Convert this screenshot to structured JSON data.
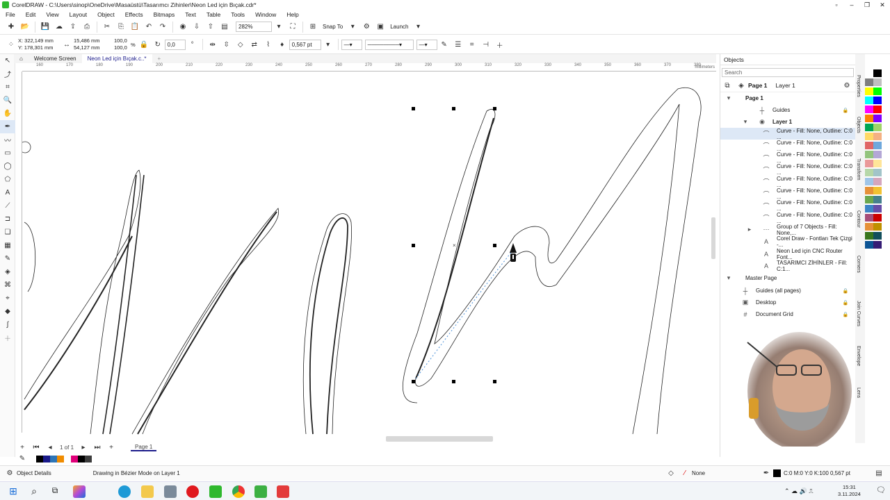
{
  "window": {
    "title": "CorelDRAW - C:\\Users\\sinop\\OneDrive\\Masaüstü\\Tasarımcı Zihinler\\Neon Led için Bıçak.cdr*"
  },
  "menu": [
    "File",
    "Edit",
    "View",
    "Layout",
    "Object",
    "Effects",
    "Bitmaps",
    "Text",
    "Table",
    "Tools",
    "Window",
    "Help"
  ],
  "toolbar": {
    "zoom": "282%",
    "snap_label": "Snap To",
    "launch_label": "Launch"
  },
  "propbar": {
    "x": "X: 322,149 mm",
    "y": "Y: 178,301 mm",
    "width": "15,486 mm",
    "height": "54,127 mm",
    "scale_x": "100,0",
    "scale_y": "100,0",
    "percent": "%",
    "angle": "0,0",
    "outline_width": "0,567 pt"
  },
  "tabs": {
    "welcome": "Welcome Screen",
    "document": "Neon Led için Bıçak.c..*",
    "add": "+"
  },
  "ruler": {
    "unit": "millimeters",
    "ticks": [
      "160",
      "170",
      "180",
      "190",
      "200",
      "210",
      "220",
      "230",
      "240",
      "250",
      "260",
      "270",
      "280",
      "290",
      "300",
      "310",
      "320",
      "330",
      "340",
      "350",
      "360",
      "370",
      "380"
    ]
  },
  "pagenav": {
    "counter": "1 of 1",
    "page_tab": "Page 1"
  },
  "objects": {
    "title": "Objects",
    "search_placeholder": "Search",
    "page_label": "Page 1",
    "layer_label": "Layer 1",
    "page_node": "Page 1",
    "guides": "Guides",
    "layer_node": "Layer 1",
    "items": [
      "Curve - Fill: None, Outline: C:0 ...",
      "Curve - Fill: None, Outline: C:0 ...",
      "Curve - Fill: None, Outline: C:0 ...",
      "Curve - Fill: None, Outline: C:0 ...",
      "Curve - Fill: None, Outline: C:0 ...",
      "Curve - Fill: None, Outline: C:0 ...",
      "Curve - Fill: None, Outline: C:0 ...",
      "Curve - Fill: None, Outline: C:0 ...",
      "Group of 7 Objects - Fill: None,...",
      "Corel Draw - Fontları Tek Çizgi -...",
      "Neon Led için CNC Router Font...",
      "TASARIMCI ZİHİNLER - Fill: C:1..."
    ],
    "master_page": "Master Page",
    "master_items": [
      "Guides (all pages)",
      "Desktop",
      "Document Grid"
    ]
  },
  "side_tabs": [
    "Properties",
    "Objects",
    "Transform",
    "Contour",
    "Corners",
    "Join Curves",
    "Envelope",
    "Lens"
  ],
  "status": {
    "object_details": "Object Details",
    "message": "Drawing in Bézier Mode on Layer 1",
    "fill": "None",
    "outline": "C:0 M:0 Y:0 K:100  0,567 pt"
  },
  "taskbar": {
    "time": "15:31",
    "date": "3.11.2024"
  },
  "colors": {
    "accent": "#1a1a8a",
    "selection": "#dde8f6",
    "node": "#000000"
  },
  "palette_right": [
    "#ffffff",
    "#000000",
    "#7f7f7f",
    "#c0c0c0",
    "#ffff00",
    "#00ff00",
    "#00ffff",
    "#0000ff",
    "#ff00ff",
    "#ff0000",
    "#ff8000",
    "#8000ff",
    "#00a651",
    "#a0d468",
    "#ffd966",
    "#f4b183",
    "#e06666",
    "#6fa8dc",
    "#93c47d",
    "#b4a7d6",
    "#ea9999",
    "#ffe599",
    "#b6d7a8",
    "#a2c4c9",
    "#9fc5e8",
    "#d5a6bd",
    "#e69138",
    "#f1c232",
    "#6aa84f",
    "#45818e",
    "#3d85c6",
    "#674ea7",
    "#a64d79",
    "#cc0000",
    "#e69138",
    "#bf9000",
    "#38761d",
    "#134f5c",
    "#0b5394",
    "#351c75"
  ],
  "palette_bottom": [
    "#ffffff",
    "#000000",
    "#1a1a8a",
    "#2e75b6",
    "#f08c00",
    "#ffffff",
    "#e0007a",
    "#000000",
    "#3c3c3c"
  ]
}
